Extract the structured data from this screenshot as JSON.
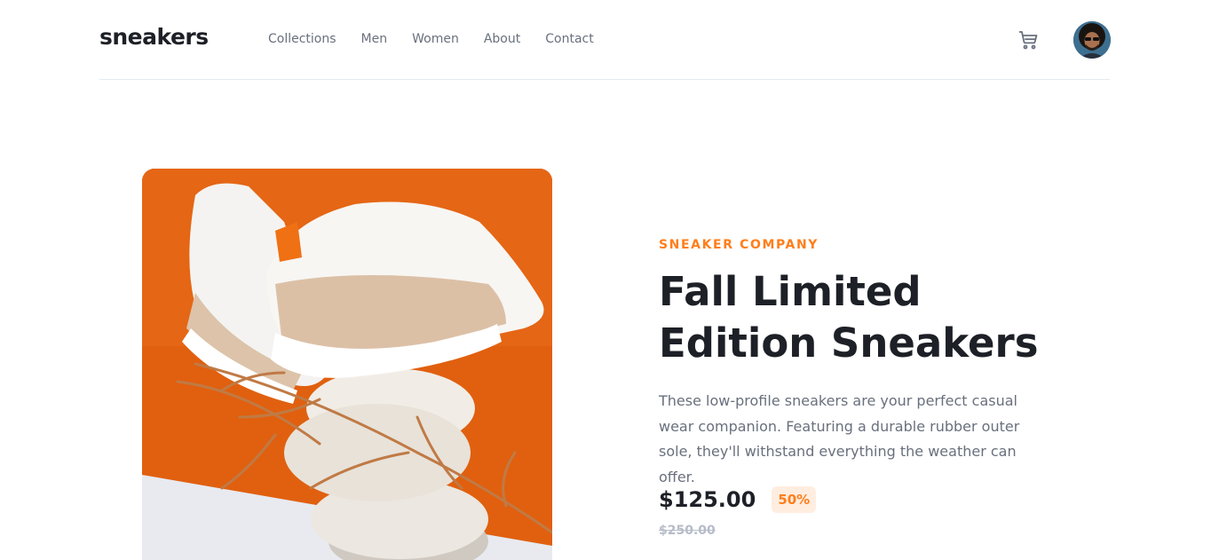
{
  "header": {
    "logo": "sneakers",
    "nav": [
      "Collections",
      "Men",
      "Women",
      "About",
      "Contact"
    ]
  },
  "product": {
    "company": "SNEAKER COMPANY",
    "title": "Fall Limited Edition Sneakers",
    "description": "These low-profile sneakers are your perfect casual wear companion. Featuring a durable rubber outer sole, they'll withstand everything the weather can offer.",
    "price": "$125.00",
    "discount": "50%",
    "original_price": "$250.00"
  },
  "colors": {
    "accent": "#ff7e1b",
    "accent_light": "#ffede0",
    "text_dark": "#1d2026",
    "text_muted": "#69707d"
  },
  "icons": {
    "cart": "cart-icon",
    "avatar": "user-avatar"
  }
}
